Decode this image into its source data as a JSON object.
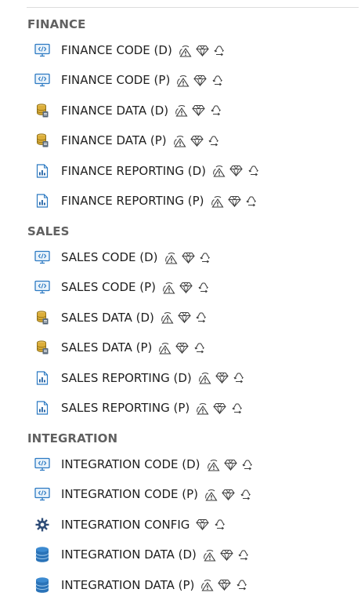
{
  "sections": [
    {
      "title": "FINANCE",
      "items": [
        {
          "label": "FINANCE CODE (D)",
          "icon": "code-monitor-icon",
          "badges": [
            "warning-icon",
            "premium-diamond-icon",
            "recycle-icon"
          ]
        },
        {
          "label": "FINANCE CODE (P)",
          "icon": "code-monitor-icon",
          "badges": [
            "warning-icon",
            "premium-diamond-icon",
            "recycle-icon"
          ]
        },
        {
          "label": "FINANCE DATA (D)",
          "icon": "data-stack-icon",
          "badges": [
            "warning-icon",
            "premium-diamond-icon",
            "recycle-icon"
          ]
        },
        {
          "label": "FINANCE DATA (P)",
          "icon": "data-stack-icon",
          "badges": [
            "warning-icon",
            "premium-diamond-icon",
            "recycle-icon"
          ]
        },
        {
          "label": "FINANCE REPORTING (D)",
          "icon": "report-chart-icon",
          "badges": [
            "warning-icon",
            "premium-diamond-icon",
            "recycle-icon"
          ]
        },
        {
          "label": "FINANCE REPORTING (P)",
          "icon": "report-chart-icon",
          "badges": [
            "warning-icon",
            "premium-diamond-icon",
            "recycle-icon"
          ]
        }
      ]
    },
    {
      "title": "SALES",
      "items": [
        {
          "label": "SALES CODE (D)",
          "icon": "code-monitor-icon",
          "badges": [
            "warning-icon",
            "premium-diamond-icon",
            "recycle-icon"
          ]
        },
        {
          "label": "SALES CODE (P)",
          "icon": "code-monitor-icon",
          "badges": [
            "warning-icon",
            "premium-diamond-icon",
            "recycle-icon"
          ]
        },
        {
          "label": "SALES DATA (D)",
          "icon": "data-stack-icon",
          "badges": [
            "warning-icon",
            "premium-diamond-icon",
            "recycle-icon"
          ]
        },
        {
          "label": "SALES DATA (P)",
          "icon": "data-stack-icon",
          "badges": [
            "warning-icon",
            "premium-diamond-icon",
            "recycle-icon"
          ]
        },
        {
          "label": "SALES REPORTING (D)",
          "icon": "report-chart-icon",
          "badges": [
            "warning-icon",
            "premium-diamond-icon",
            "recycle-icon"
          ]
        },
        {
          "label": "SALES REPORTING (P)",
          "icon": "report-chart-icon",
          "badges": [
            "warning-icon",
            "premium-diamond-icon",
            "recycle-icon"
          ]
        }
      ]
    },
    {
      "title": "INTEGRATION",
      "items": [
        {
          "label": "INTEGRATION CODE (D)",
          "icon": "code-monitor-icon",
          "badges": [
            "warning-icon",
            "premium-diamond-icon",
            "recycle-icon"
          ]
        },
        {
          "label": "INTEGRATION CODE (P)",
          "icon": "code-monitor-icon",
          "badges": [
            "warning-icon",
            "premium-diamond-icon",
            "recycle-icon"
          ]
        },
        {
          "label": "INTEGRATION CONFIG",
          "icon": "gear-icon",
          "badges": [
            "premium-diamond-icon",
            "recycle-icon"
          ]
        },
        {
          "label": "INTEGRATION DATA (D)",
          "icon": "database-icon",
          "badges": [
            "warning-icon",
            "premium-diamond-icon",
            "recycle-icon"
          ]
        },
        {
          "label": "INTEGRATION DATA (P)",
          "icon": "database-icon",
          "badges": [
            "warning-icon",
            "premium-diamond-icon",
            "recycle-icon"
          ]
        }
      ]
    }
  ]
}
